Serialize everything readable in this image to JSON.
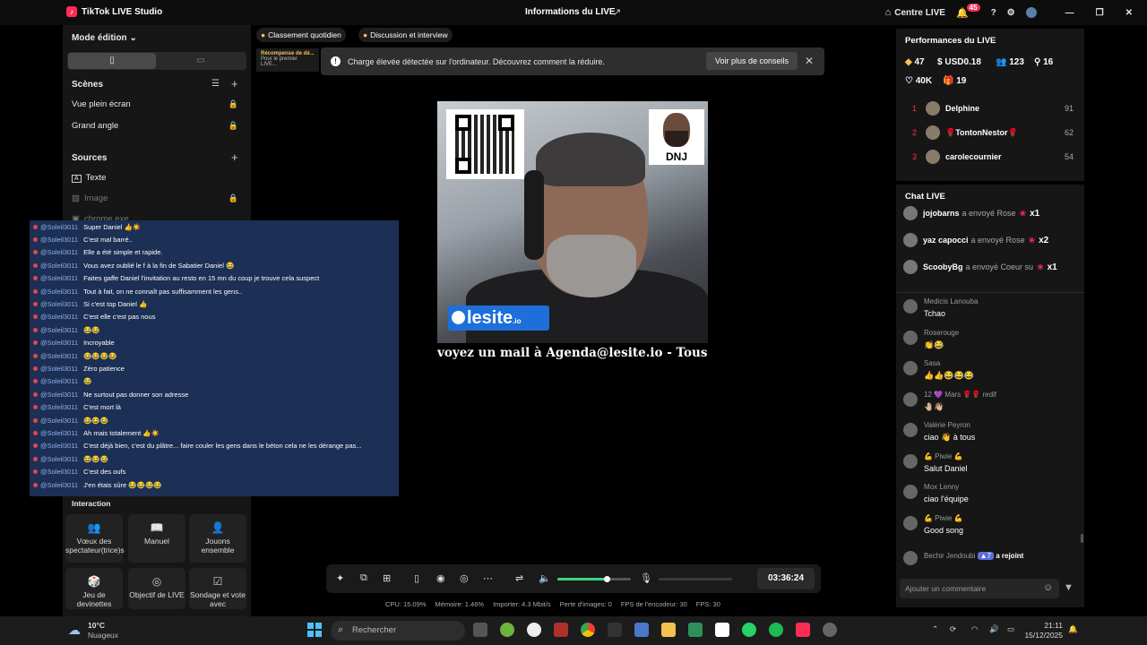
{
  "titlebar": {
    "app_name": "TikTok LIVE Studio",
    "center_title": "Informations du LIVE",
    "centre_live": "Centre LIVE",
    "notif_count": "45"
  },
  "left": {
    "mode": "Mode édition",
    "scenes_title": "Scènes",
    "scenes": [
      "Vue plein écran",
      "Grand angle"
    ],
    "sources_title": "Sources",
    "sources": [
      "Texte",
      "Image",
      "chrome.exe"
    ],
    "interaction_title": "Interaction",
    "interactions": [
      "Vœux des spectateur(trice)s",
      "Manuel",
      "Jouons ensemble",
      "Jeu de devinettes",
      "Objectif de LIVE",
      "Sondage et vote avec"
    ]
  },
  "pills": {
    "daily": "Classement quotidien",
    "discussion": "Discussion et interview"
  },
  "recompense": {
    "title": "Récompense de dé...",
    "sub": "Pour le premier LIVE..."
  },
  "toast": {
    "message": "Charge élevée détectée sur l'ordinateur. Découvrez comment la réduire.",
    "button": "Voir plus de conseils"
  },
  "overlay_chat": {
    "user": "@Soleil3011",
    "messages": [
      "Super Daniel 👍☀️",
      "C'est mal barré..",
      "Elle a été simple et rapide.",
      "Vous avez oublié le f à la fin de Sabatier Daniel 😂",
      "Faites gaffe Daniel l'invitation au resto en 15 mn du coup je trouve cela suspect",
      "Tout à fait, on ne connaît pas suffisamment les gens..",
      "Si c'est top Daniel 👍",
      "C'est elle c'est pas nous",
      "😂😂",
      "Incroyable",
      "😂😂😂😂",
      "Zéro patience",
      "😂",
      "Ne surtout pas donner son adresse",
      "C'est mort là",
      "😂😂😂",
      "Ah mais totalement 👍☀️",
      "C'est déjà bien, c'est du plâtre... faire couler les gens dans le béton cela ne les dérange pas...",
      "😂😂😂",
      "C'est des oufs",
      "J'en étais sûre 😂😂😂😂"
    ]
  },
  "preview": {
    "dnj": "DNJ",
    "lesite": "lesite",
    "lesite_io": ".io",
    "ticker": "voyez un mail à Agenda@lesite.io - Tous les lien"
  },
  "toolbar": {
    "timer": "03:36:24",
    "volume_level": 0.67
  },
  "stats": {
    "cpu": "CPU: 15.09%",
    "memory": "Mémoire: 1.46%",
    "upload": "Importer: 4.3 Mbit/s",
    "frame_loss": "Perte d'images: 0",
    "encoder_fps": "FPS de l'encodeur: 30",
    "fps": "FPS: 30"
  },
  "performance": {
    "title": "Performances du LIVE",
    "diamonds": "47",
    "usd": "USD0.18",
    "viewers": "123",
    "followers": "16",
    "likes": "40K",
    "gifts": "19",
    "ranking": [
      {
        "rank": "1",
        "name": "Delphine",
        "score": "91"
      },
      {
        "rank": "2",
        "name": "🌹TontonNestor🌹",
        "score": "62"
      },
      {
        "rank": "3",
        "name": "carolecournier",
        "score": "54"
      }
    ]
  },
  "chat_live": {
    "title": "Chat LIVE",
    "gifts": [
      {
        "name": "jojobarns",
        "action": "a envoyé Rose",
        "count": "x1"
      },
      {
        "name": "yaz capocci",
        "action": "a envoyé Rose",
        "count": "x2"
      },
      {
        "name": "ScoobyBg",
        "action": "a envoyé Coeur su",
        "count": "x1"
      }
    ],
    "comments": [
      {
        "name": "Medicis Lanouba",
        "text": "Tchao"
      },
      {
        "name": "Roserouge",
        "text": "👏😂"
      },
      {
        "name": "Sasa",
        "text": "👍👍😂😂😂"
      },
      {
        "name": "12 💜 Mars 🌹🌹 redif",
        "text": "🤚🏼👋🏼"
      },
      {
        "name": "Valérie Peyron",
        "text": "ciao 👋 à tous"
      },
      {
        "name": "💪 Piwie 💪",
        "text": "Salut Daniel"
      },
      {
        "name": "Mox Lenny",
        "text": "ciao l'équipe"
      },
      {
        "name": "💪 Piwie 💪",
        "text": "Good song"
      }
    ],
    "joined_name": "Bechir Jendoubi",
    "joined_level": "7",
    "joined_text": "a rejoint",
    "comment_placeholder": "Ajouter un commentaire"
  },
  "taskbar": {
    "weather_temp": "10°C",
    "weather_desc": "Nuageux",
    "search": "Rechercher",
    "time": "21:11",
    "date": "15/12/2025"
  }
}
